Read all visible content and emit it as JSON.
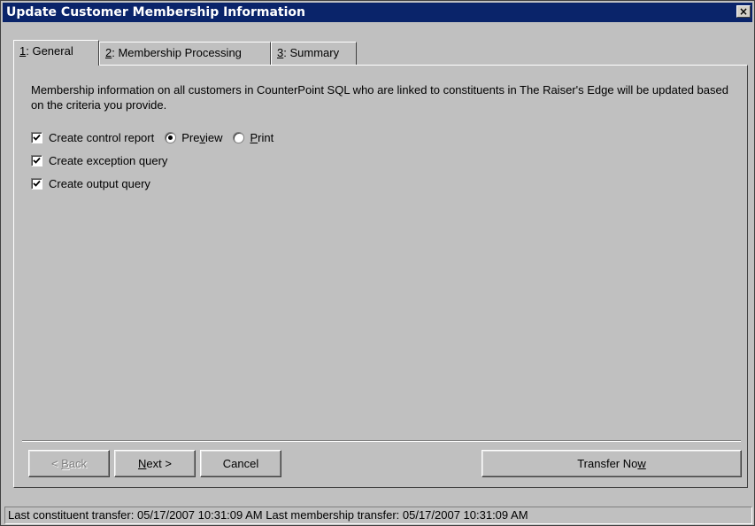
{
  "window": {
    "title": "Update Customer Membership Information",
    "close_label": "×"
  },
  "tabs": [
    {
      "key": "1",
      "label": ": General",
      "active": true
    },
    {
      "key": "2",
      "label": ": Membership Processing",
      "active": false
    },
    {
      "key": "3",
      "label": ": Summary",
      "active": false
    }
  ],
  "general": {
    "description": "Membership information on all customers in CounterPoint SQL who are linked to constituents in The Raiser's Edge will be updated based on the criteria you provide.",
    "options": {
      "control_report": {
        "label": "Create control report",
        "checked": true
      },
      "preview": {
        "pre": "Pre",
        "key": "v",
        "post": "iew",
        "selected": true
      },
      "print": {
        "key": "P",
        "post": "rint",
        "selected": false
      },
      "exception_query": {
        "label": "Create exception query",
        "checked": true
      },
      "output_query": {
        "label": "Create output query",
        "checked": true
      }
    }
  },
  "buttons": {
    "back": {
      "prefix": "< ",
      "key": "B",
      "post": "ack",
      "enabled": false
    },
    "next": {
      "key": "N",
      "post": "ext >"
    },
    "cancel": {
      "label": "Cancel"
    },
    "transfer": {
      "pre": "Transfer No",
      "key": "w"
    }
  },
  "status": {
    "text": "Last constituent transfer: 05/17/2007 10:31:09 AM   Last membership transfer: 05/17/2007 10:31:09 AM"
  },
  "colors": {
    "titlebar": "#0a246a",
    "face": "#c0c0c0"
  }
}
